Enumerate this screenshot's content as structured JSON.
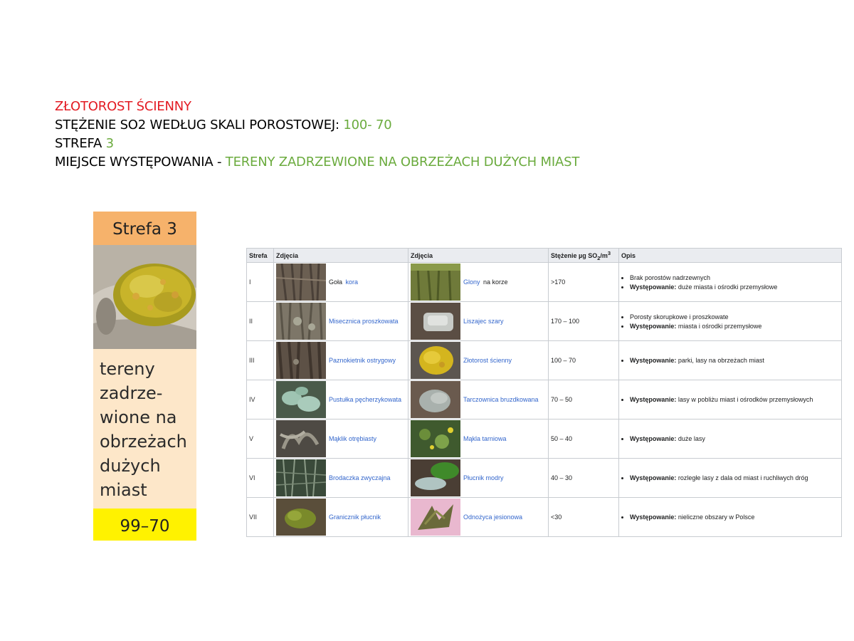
{
  "header": {
    "name": "ZŁOTOROST ŚCIENNY",
    "concentration_label": "STĘŻENIE SO2 WEDŁUG SKALI POROSTOWEJ",
    "concentration_value": "100- 70",
    "zone_label": "STREFA",
    "zone_value": "3",
    "occurrence_label": "MIEJSCE WYSTĘPOWANIA",
    "occurrence_value": "TERENY ZADRZEWIONE NA OBRZEŻACH DUŻYCH MIAST"
  },
  "card": {
    "title": "Strefa 3",
    "text": "tereny\nzadrze-\nwione na\nobrzeżach\ndużych\nmiast",
    "range": "99–70",
    "colors": {
      "title_bg": "#f6b26b",
      "body_bg": "#fde7c9",
      "range_bg": "#fff200"
    }
  },
  "table": {
    "headers": {
      "zone": "Strefa",
      "photos1": "Zdjęcia",
      "photos2": "Zdjęcia",
      "concentration": "Stężenie µg SO",
      "concentration_sub": "2",
      "concentration_unit": "/m",
      "concentration_sup": "3",
      "description": "Opis"
    },
    "rows": [
      {
        "zone": "I",
        "left": {
          "pre": "Goła",
          "link": "kora",
          "post": ""
        },
        "right": {
          "pre": "",
          "link": "Glony",
          "post": "na korze"
        },
        "value": ">170",
        "desc": [
          {
            "bold": "",
            "text": "Brak porostów nadrzewnych"
          },
          {
            "bold": "Występowanie:",
            "text": "duże miasta i ośrodki przemysłowe"
          }
        ]
      },
      {
        "zone": "II",
        "left": {
          "pre": "",
          "link": "Misecznica proszkowata",
          "post": ""
        },
        "right": {
          "pre": "",
          "link": "Liszajec szary",
          "post": ""
        },
        "value": "170 – 100",
        "desc": [
          {
            "bold": "",
            "text": "Porosty skorupkowe i proszkowate"
          },
          {
            "bold": "Występowanie:",
            "text": "miasta i ośrodki przemysłowe"
          }
        ]
      },
      {
        "zone": "III",
        "left": {
          "pre": "",
          "link": "Paznokietnik ostrygowy",
          "post": ""
        },
        "right": {
          "pre": "",
          "link": "Złotorost ścienny",
          "post": ""
        },
        "value": "100 – 70",
        "desc": [
          {
            "bold": "Występowanie:",
            "text": "parki, lasy na obrzeżach miast"
          }
        ]
      },
      {
        "zone": "IV",
        "left": {
          "pre": "",
          "link": "Pustułka pęcherzykowata",
          "post": ""
        },
        "right": {
          "pre": "",
          "link": "Tarczownica bruzdkowana",
          "post": ""
        },
        "value": "70 – 50",
        "desc": [
          {
            "bold": "Występowanie:",
            "text": "lasy w pobliżu miast i ośrodków przemysłowych"
          }
        ]
      },
      {
        "zone": "V",
        "left": {
          "pre": "",
          "link": "Mąklik otrębiasty",
          "post": ""
        },
        "right": {
          "pre": "",
          "link": "Mąkla tarniowa",
          "post": ""
        },
        "value": "50 – 40",
        "desc": [
          {
            "bold": "Występowanie:",
            "text": "duże lasy"
          }
        ]
      },
      {
        "zone": "VI",
        "left": {
          "pre": "",
          "link": "Brodaczka zwyczajna",
          "post": ""
        },
        "right": {
          "pre": "",
          "link": "Płucnik modry",
          "post": ""
        },
        "value": "40 – 30",
        "desc": [
          {
            "bold": "Występowanie:",
            "text": "rozległe lasy z dala od miast i ruchliwych dróg"
          }
        ]
      },
      {
        "zone": "VII",
        "left": {
          "pre": "",
          "link": "Granicznik płucnik",
          "post": ""
        },
        "right": {
          "pre": "",
          "link": "Odnożyca jesionowa",
          "post": ""
        },
        "value": "<30",
        "desc": [
          {
            "bold": "Występowanie:",
            "text": "nieliczne obszary w Polsce"
          }
        ]
      }
    ]
  }
}
